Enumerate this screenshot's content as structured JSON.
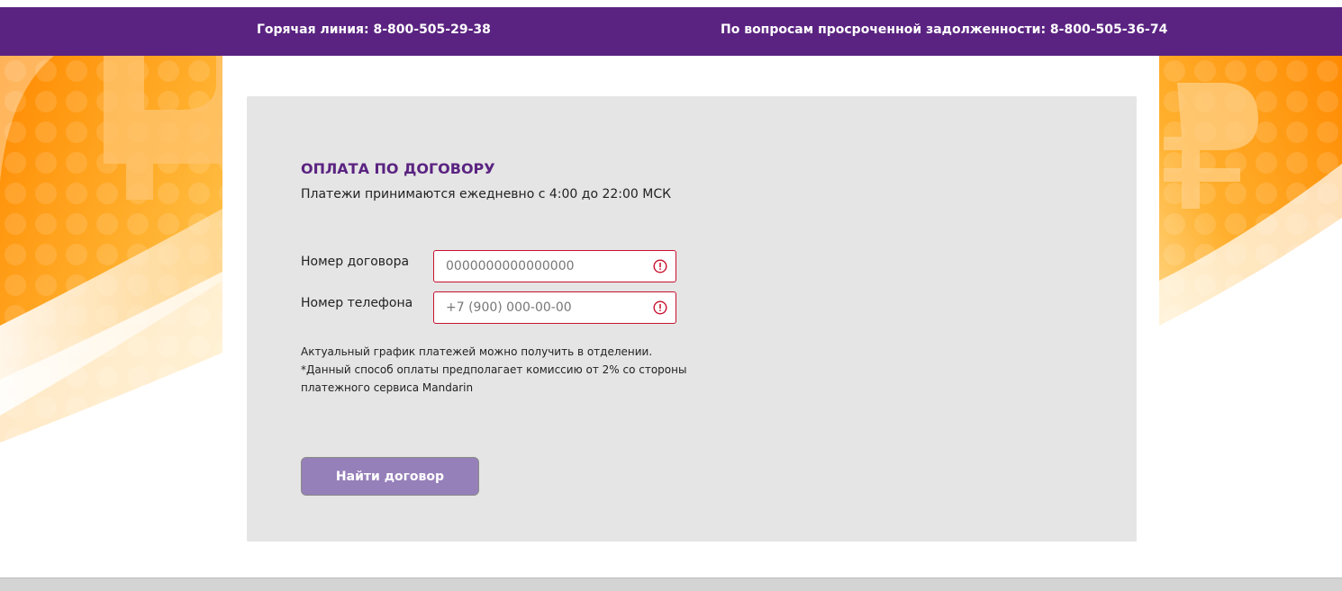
{
  "header": {
    "hotline": "Горячая линия: 8-800-505-29-38",
    "debt_line": "По вопросам просроченной задолженности: 8-800-505-36-74",
    "background_color": "#5a2381"
  },
  "form": {
    "title": "ОПЛАТА ПО ДОГОВОРУ",
    "subtitle": "Платежи принимаются ежедневно с 4:00 до 22:00 МСК",
    "contract_label": "Номер договора",
    "contract_placeholder": "0000000000000000",
    "contract_value": "",
    "phone_label": "Номер телефона",
    "phone_placeholder": "+7 (900) 000-00-00",
    "phone_value": "",
    "error_icon": "alert-circle-icon",
    "error_color": "#c8102e",
    "note_lines": [
      "Актуальный график платежей можно получить в отделении.",
      "*Данный способ оплаты предполагает комиссию от 2% со стороны",
      "платежного сервиса Mandarin"
    ],
    "submit_label": "Найти договор",
    "accent_color": "#5a2381",
    "button_color": "#9680b9"
  }
}
